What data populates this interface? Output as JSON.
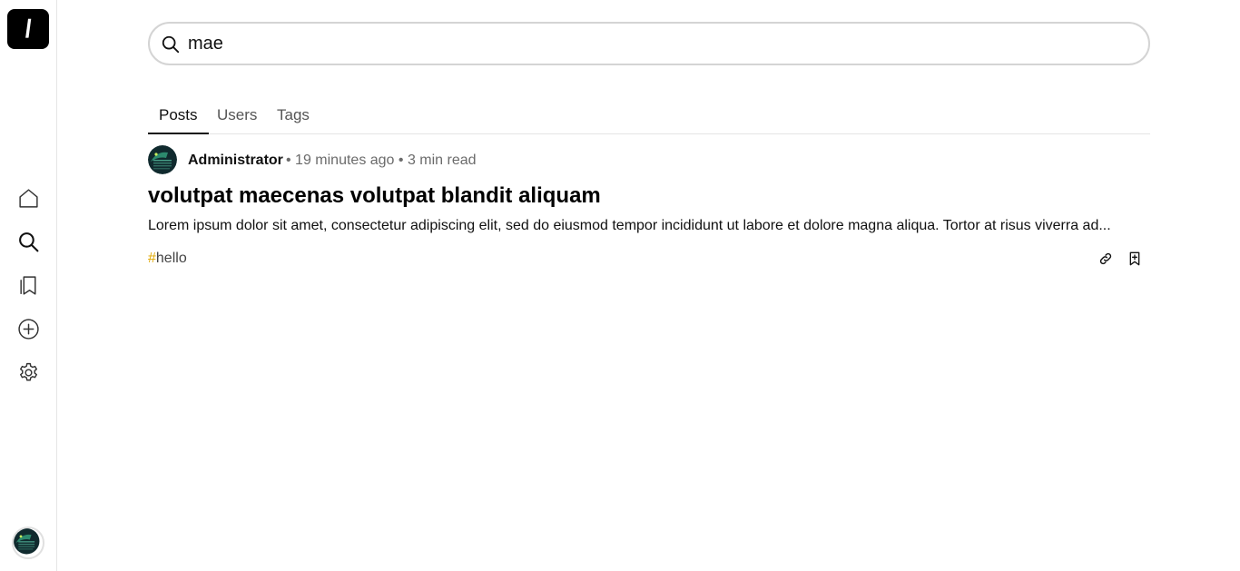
{
  "sidebar": {
    "logo_text": "\\",
    "items": [
      {
        "name": "home",
        "icon": "home-icon"
      },
      {
        "name": "search",
        "icon": "search-icon"
      },
      {
        "name": "bookmarks",
        "icon": "bookmark-icon"
      },
      {
        "name": "new-post",
        "icon": "plus-circle-icon"
      },
      {
        "name": "settings",
        "icon": "gear-icon"
      }
    ],
    "avatar_icon": "user-avatar"
  },
  "search": {
    "value": "mae",
    "placeholder": "Search"
  },
  "tabs": [
    {
      "label": "Posts",
      "active": true
    },
    {
      "label": "Users",
      "active": false
    },
    {
      "label": "Tags",
      "active": false
    }
  ],
  "results": [
    {
      "author": "Administrator",
      "time": "19 minutes ago",
      "read_time": "3 min read",
      "meta_line": "• 19 minutes ago • 3 min read",
      "title": "volutpat maecenas volutpat blandit aliquam",
      "excerpt": "Lorem ipsum dolor sit amet, consectetur adipiscing elit, sed do eiusmod tempor incididunt ut labore et dolore magna aliqua. Tortor at risus viverra ad...",
      "tag_hash": "#",
      "tag": "hello",
      "actions": [
        "link-icon",
        "bookmark-add-icon"
      ]
    }
  ],
  "colors": {
    "tag_hash": "#e0a800",
    "border": "#d4d4d4",
    "muted_text": "#6b6b6b"
  }
}
